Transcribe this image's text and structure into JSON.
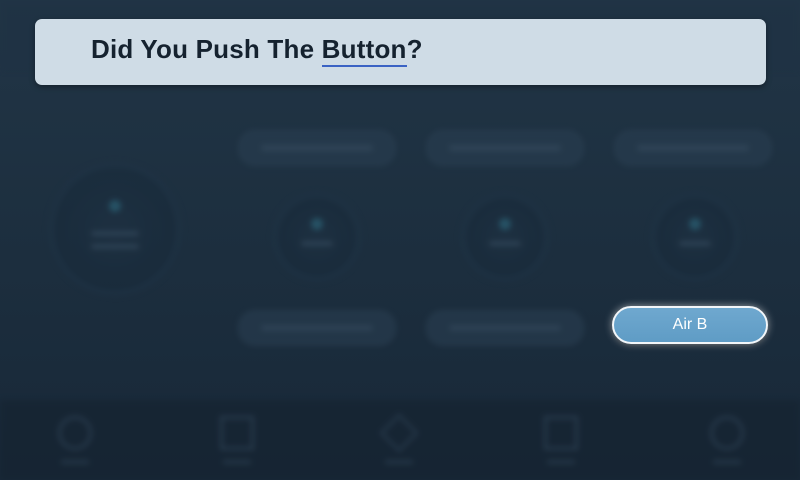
{
  "dialog": {
    "title_before": "Did You Push The ",
    "title_link": "Button",
    "title_after": "?"
  },
  "buttons": {
    "air_b_label": "Air B"
  },
  "colors": {
    "banner_bg": "#cfdce6",
    "title_text": "#15222f",
    "link_underline": "#3b63c4",
    "button_fill": "#64a0c8",
    "background": "#1b2c3b"
  },
  "background_app": {
    "state": "blurred",
    "nav_icons": [
      "home-icon",
      "document-icon",
      "diamond-icon",
      "grid-icon",
      "settings-icon"
    ]
  }
}
